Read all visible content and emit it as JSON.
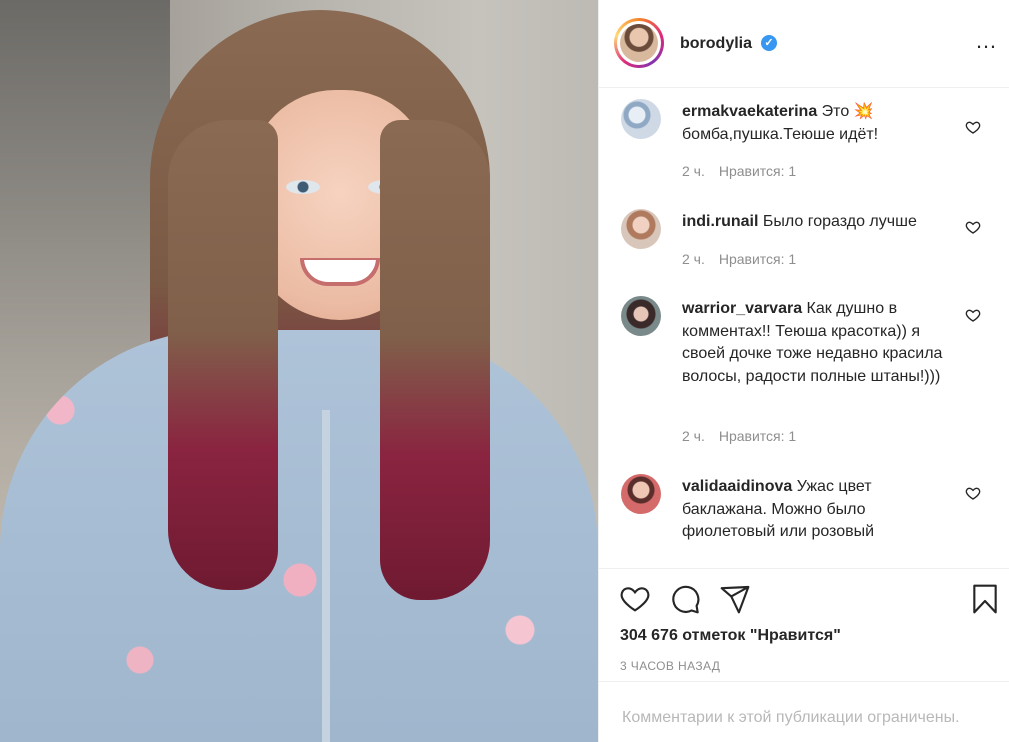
{
  "post": {
    "username": "borodylia",
    "verified_mark": "✓",
    "more_icon": "…"
  },
  "comments": [
    {
      "user": "ermakvaekaterina",
      "text": "Это 💥 бомба,пушка.Теюше идёт!",
      "time": "2 ч.",
      "likes": "Нравится: 1"
    },
    {
      "user": "indi.runail",
      "text": "Было гораздо лучше",
      "time": "2 ч.",
      "likes": "Нравится: 1"
    },
    {
      "user": "warrior_varvara",
      "text": "Как душно в комментах!! Теюша красотка)) я своей дочке тоже недавно красила волосы, радости полные штаны!)))",
      "time": "2 ч.",
      "likes": "Нравится: 1"
    },
    {
      "user": "validaaidinova",
      "text": "Ужас цвет баклажана. Можно было фиолетовый или розовый",
      "time": "",
      "likes": ""
    }
  ],
  "footer": {
    "likes_count": "304 676 отметок \"Нравится\"",
    "time_ago": "3 ЧАСОВ НАЗАД",
    "comments_restricted": "Комментарии к этой публикации ограничены."
  },
  "icons": {
    "like": "heart-icon",
    "comment": "comment-icon",
    "share": "share-icon",
    "save": "bookmark-icon"
  }
}
